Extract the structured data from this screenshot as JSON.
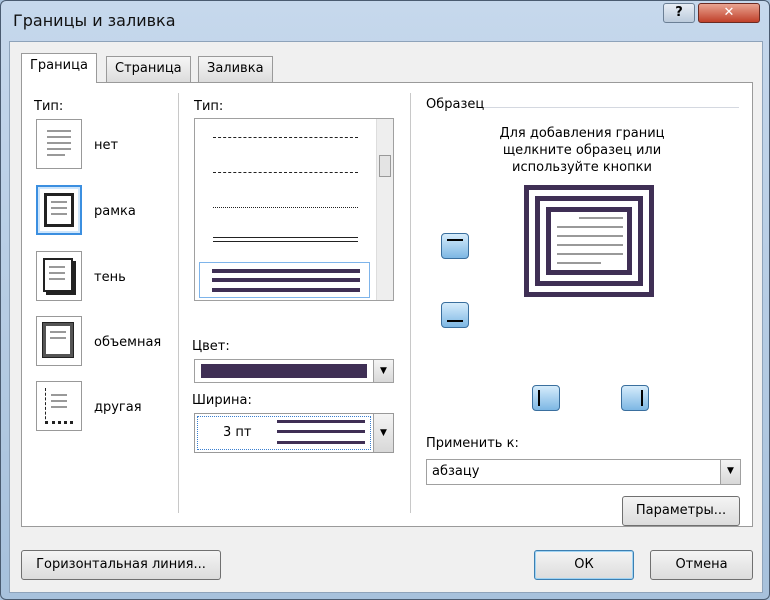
{
  "window": {
    "title": "Границы и заливка",
    "help": "?",
    "close": "✕"
  },
  "tabs": [
    {
      "label": "Граница",
      "u": "Г",
      "rest": "раница"
    },
    {
      "label": "Страница",
      "u": "С",
      "rest": "траница"
    },
    {
      "label": "Заливка",
      "u": "З",
      "rest": "аливка"
    }
  ],
  "settings": {
    "label": "Тип:",
    "items": [
      {
        "label": "нет"
      },
      {
        "label": "рамка"
      },
      {
        "label": "тень"
      },
      {
        "label": "объемная"
      },
      {
        "label": "другая"
      }
    ]
  },
  "style": {
    "label": "Тип:"
  },
  "color": {
    "label": "Цвет:",
    "value": "#3f2f55"
  },
  "width": {
    "label": "Ширина:",
    "value": "3 пт"
  },
  "preview": {
    "label": "Образец",
    "hint": [
      "Для добавления границ",
      "щелкните образец или",
      "используйте кнопки"
    ]
  },
  "apply": {
    "label": "Применить к:",
    "value": "абзацу"
  },
  "buttons": {
    "options": "Параметры...",
    "hline": "Горизонтальная линия...",
    "ok": "ОК",
    "cancel": "Отмена"
  }
}
